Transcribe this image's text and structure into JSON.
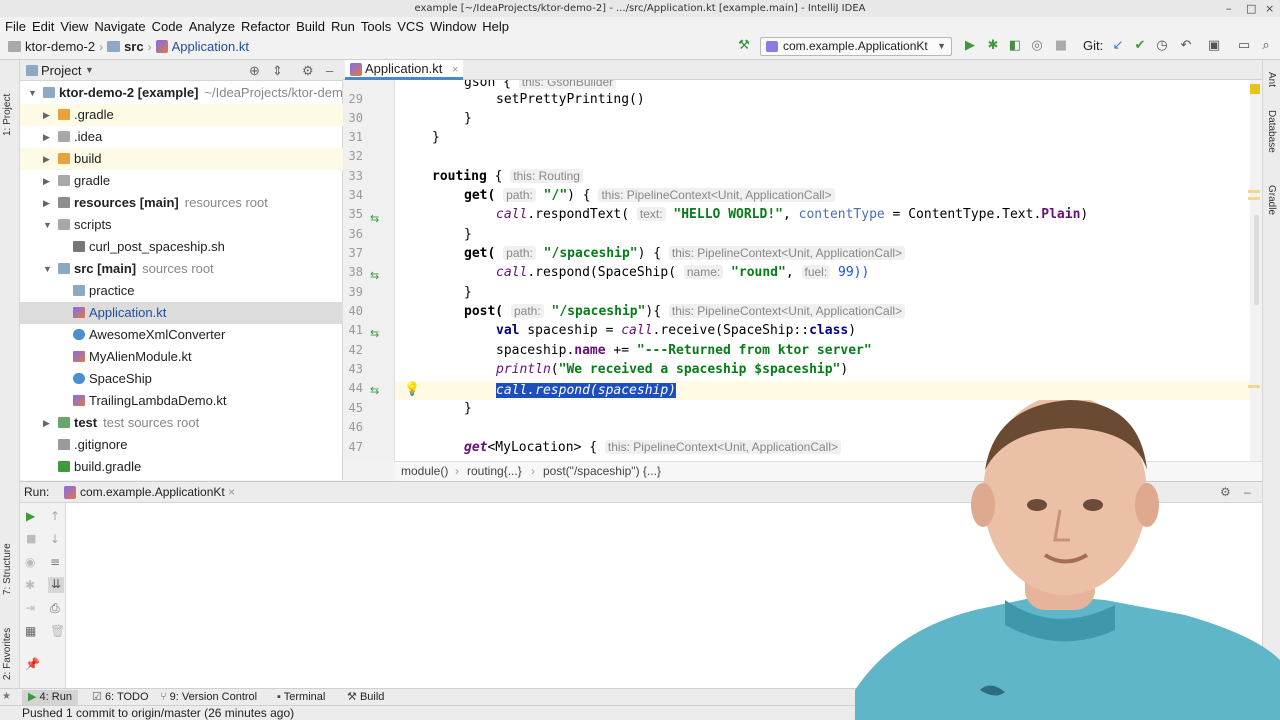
{
  "window": {
    "title": "example [~/IdeaProjects/ktor-demo-2] - .../src/Application.kt [example.main] - IntelliJ IDEA"
  },
  "menu": [
    "File",
    "Edit",
    "View",
    "Navigate",
    "Code",
    "Analyze",
    "Refactor",
    "Build",
    "Run",
    "Tools",
    "VCS",
    "Window",
    "Help"
  ],
  "nav": {
    "project": "ktor-demo-2",
    "folder": "src",
    "file": "Application.kt",
    "run_config": "com.example.ApplicationKt",
    "git_label": "Git:"
  },
  "side_tabs": {
    "project": "1: Project",
    "structure": "7: Structure",
    "favorites": "2: Favorites",
    "ant": "Ant",
    "database": "Database",
    "gradle": "Gradle"
  },
  "project_panel": {
    "title": "Project",
    "tree": [
      {
        "label": "ktor-demo-2 [example]",
        "hint": "~/IdeaProjects/ktor-demo",
        "bold": true
      },
      {
        "label": ".gradle",
        "hint": "",
        "bold": false
      },
      {
        "label": ".idea",
        "hint": "",
        "bold": false
      },
      {
        "label": "build",
        "hint": "",
        "bold": false
      },
      {
        "label": "gradle",
        "hint": "",
        "bold": false
      },
      {
        "label": "resources [main]",
        "hint": "resources root",
        "bold": true
      },
      {
        "label": "scripts",
        "hint": "",
        "bold": false
      },
      {
        "label": "curl_post_spaceship.sh",
        "hint": "",
        "bold": false
      },
      {
        "label": "src [main]",
        "hint": "sources root",
        "bold": true
      },
      {
        "label": "practice",
        "hint": "",
        "bold": false
      },
      {
        "label": "Application.kt",
        "hint": "",
        "bold": false
      },
      {
        "label": "AwesomeXmlConverter",
        "hint": "",
        "bold": false
      },
      {
        "label": "MyAlienModule.kt",
        "hint": "",
        "bold": false
      },
      {
        "label": "SpaceShip",
        "hint": "",
        "bold": false
      },
      {
        "label": "TrailingLambdaDemo.kt",
        "hint": "",
        "bold": false
      },
      {
        "label": "test",
        "hint": "test sources root",
        "bold": true
      },
      {
        "label": ".gitignore",
        "hint": "",
        "bold": false
      },
      {
        "label": "build.gradle",
        "hint": "",
        "bold": false
      }
    ]
  },
  "editor": {
    "tab": "Application.kt",
    "line_numbers": [
      "29",
      "30",
      "31",
      "32",
      "33",
      "34",
      "35",
      "36",
      "37",
      "38",
      "39",
      "40",
      "41",
      "42",
      "43",
      "44",
      "45",
      "46",
      "47"
    ],
    "t": {
      "gson": "gson {",
      "this_gson": "this: GsonBuilder",
      "pretty": "setPrettyPrinting()",
      "rb": "}",
      "routing": "routing",
      "lb": "{",
      "this_routing": "this: Routing",
      "get": "get(",
      "path": "path:",
      "root": "\"/\"",
      "close_lb": ") {",
      "close_lb2": "){",
      "this_pc": "this: PipelineContext<Unit, ApplicationCall>",
      "call": "call",
      "respondText": ".respondText(",
      "text_hint": "text:",
      "hello": "\"HELLO WORLD!\"",
      "comma": ",",
      "contentType": "contentType",
      "eq": " = ",
      "ctText": "ContentType.Text.",
      "plain": "Plain",
      "rp": ")",
      "spaceship_path": "\"/spaceship\"",
      "respond": ".respond(SpaceShip(",
      "name_hint": "name:",
      "round": "\"round\"",
      "fuel_hint": "fuel:",
      "fuel_val": "99))",
      "post": "post(",
      "val": "val",
      "val_rest": " spaceship = ",
      "receive": ".receive(SpaceShip::",
      "class": "class",
      "ss": "spaceship.",
      "name": "name",
      "plus": " += ",
      "returned": "\"---Returned from ktor server\"",
      "println": "println",
      "lp": "(",
      "received": "\"We received a spaceship $spaceship\"",
      "selected": "call.respond(spaceship)",
      "get_it": "get",
      "myloc": "<MyLocation> {"
    },
    "breadcrumbs": [
      "module()",
      "routing{...}",
      "post(\"/spaceship\") {...}"
    ]
  },
  "run_panel": {
    "label": "Run:",
    "tab": "com.example.ApplicationKt"
  },
  "tool_windows": [
    "4: Run",
    "6: TODO",
    "9: Version Control",
    "Terminal",
    "Build"
  ],
  "status_bar": "Pushed 1 commit to origin/master (26 minutes ago)",
  "colors": {
    "accent": "#4a88c7",
    "selection": "#1c4fbd",
    "string": "#067d17",
    "keyword": "#000080"
  }
}
